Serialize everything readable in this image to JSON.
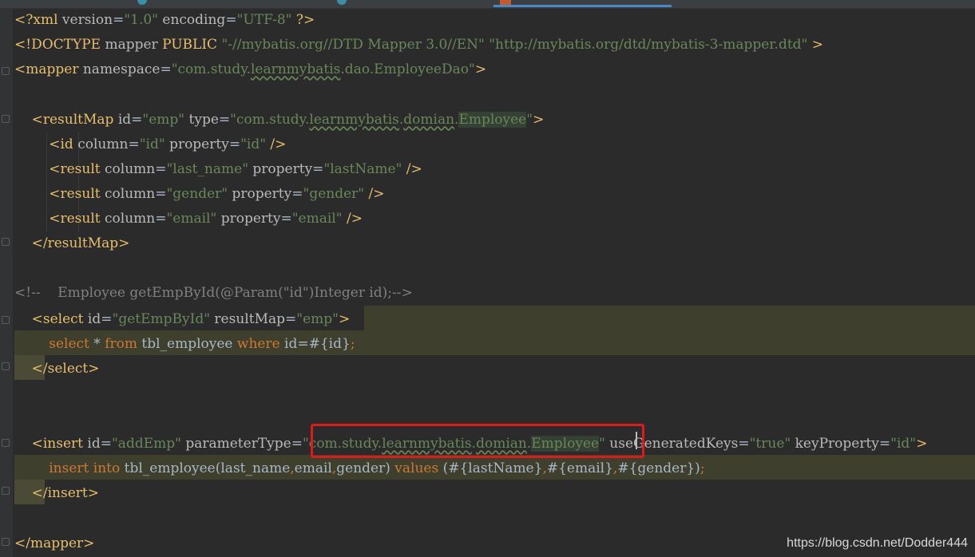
{
  "editor": {
    "lines": {
      "l1": {
        "open": "<?xml",
        "a1": " version",
        "eq1": "=",
        "v1": "\"1.0\"",
        "a2": " encoding",
        "eq2": "=",
        "v2": "\"UTF-8\"",
        "close": " ?>"
      },
      "l2": {
        "open": "<!DOCTYPE",
        "p1": " mapper ",
        "kw": "PUBLIC",
        "p2": " ",
        "v1": "\"-//mybatis.org//DTD Mapper 3.0//EN\"",
        "p3": " ",
        "v2": "\"http://mybatis.org/dtd/mybatis-3-mapper.dtd\"",
        "close": " >"
      },
      "l3": {
        "open": "<mapper",
        "a1": " namespace",
        "eq": "=",
        "q1": "\"",
        "v_pre": "com.study.",
        "v_sq": "learnmybatis",
        "v_post": ".dao.EmployeeDao",
        "q2": "\"",
        "close": ">"
      },
      "l5": {
        "indent": "    ",
        "open": "<resultMap",
        "a1": " id",
        "eq1": "=",
        "v1": "\"emp\"",
        "a2": " type",
        "eq2": "=",
        "q1": "\"",
        "v_pre": "com.study.",
        "v_sq1": "learnmybatis",
        "dot1": ".",
        "v_sq2": "domian",
        "dot2": ".",
        "v_match": "Employee",
        "q2": "\"",
        "close": ">"
      },
      "l6": {
        "indent": "        ",
        "open": "<id",
        "a1": " column",
        "eq1": "=",
        "v1": "\"id\"",
        "a2": " property",
        "eq2": "=",
        "v2": "\"id\"",
        "close": " />"
      },
      "l7": {
        "indent": "        ",
        "open": "<result",
        "a1": " column",
        "eq1": "=",
        "v1": "\"last_name\"",
        "a2": " property",
        "eq2": "=",
        "v2": "\"lastName\"",
        "close": " />"
      },
      "l8": {
        "indent": "        ",
        "open": "<result",
        "a1": " column",
        "eq1": "=",
        "v1": "\"gender\"",
        "a2": " property",
        "eq2": "=",
        "v2": "\"gender\"",
        "close": " />"
      },
      "l9": {
        "indent": "        ",
        "open": "<result",
        "a1": " column",
        "eq1": "=",
        "v1": "\"email\"",
        "a2": " property",
        "eq2": "=",
        "v2": "\"email\"",
        "close": " />"
      },
      "l10": {
        "indent": "    ",
        "tag": "</resultMap>"
      },
      "l12": {
        "comment": "<!--    Employee getEmpById(@Param(\"id\")Integer id);-->"
      },
      "l13": {
        "indent": "    ",
        "open": "<select",
        "a1": " id",
        "eq1": "=",
        "v1": "\"getEmpById\"",
        "a2": " resultMap",
        "eq2": "=",
        "v2": "\"emp\"",
        "close": ">"
      },
      "l14": {
        "indent": "        ",
        "k1": "select",
        "s1": " * ",
        "k2": "from",
        "s2": " tbl_employee ",
        "k3": "where",
        "s3": " id=#{id}",
        "k4": ";"
      },
      "l15": {
        "indent": "    ",
        "tag": "</select>"
      },
      "l18": {
        "indent": "    ",
        "open": "<insert",
        "a1": " id",
        "eq1": "=",
        "v1": "\"addEmp\"",
        "a2": " parameterType",
        "eq2": "=",
        "q1": "\"",
        "v_pre": "com.study.",
        "v_sq1": "learnmybatis",
        "dot1": ".",
        "v_sq2": "domian",
        "dot2": ".",
        "v_match": "Employee",
        "q2": "\"",
        "a3": " useGeneratedKeys",
        "eq3": "=",
        "v3": "\"true\"",
        "a4": " keyProperty",
        "eq4": "=",
        "v4": "\"id\"",
        "close": ">"
      },
      "l19": {
        "indent": "        ",
        "k1": "insert into",
        "s1": " tbl_employee(last_name",
        "c1": ",",
        "s2": "email",
        "c2": ",",
        "s3": "gender) ",
        "k2": "values",
        "s4": " (#{lastName}",
        "c3": ",",
        "s5": "#{email}",
        "c4": ",",
        "s6": "#{gender})",
        "k3": ";"
      },
      "l20": {
        "indent": "    ",
        "tag": "</insert>"
      },
      "l22": {
        "tag": "</mapper>"
      }
    }
  },
  "watermark": "https://blog.csdn.net/Dodder444",
  "colors": {
    "background": "#2b2b2b",
    "tag": "#e8bf6a",
    "string": "#6a8759",
    "keyword": "#cc7832",
    "comment": "#808080",
    "highlight_box": "#e0191b"
  }
}
